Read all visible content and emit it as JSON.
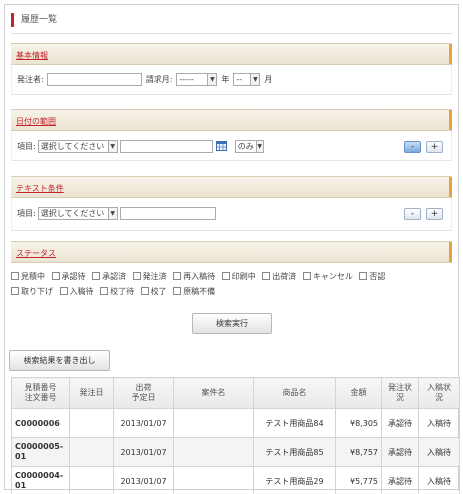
{
  "page": {
    "title": "履歴一覧"
  },
  "basic": {
    "heading": "基本情報",
    "orderer_label": "発注者:",
    "orderer_value": "",
    "billing_month_label": "請求月:",
    "year_value": "-----",
    "year_label": "年",
    "month_value": "--",
    "month_label": "月"
  },
  "date_range": {
    "heading": "日付の範囲",
    "item_label": "項目:",
    "item_select": "選択してください",
    "date_value": "",
    "mode_select": "のみ",
    "minus_label": "-",
    "plus_label": "+"
  },
  "text_cond": {
    "heading": "テキスト条件",
    "item_label": "項目:",
    "item_select": "選択してください",
    "text_value": "",
    "minus_label": "-",
    "plus_label": "+"
  },
  "status": {
    "heading": "ステータス",
    "options": [
      "見積中",
      "承認待",
      "承認済",
      "発注済",
      "再入稿待",
      "印刷中",
      "出荷済",
      "キャンセル",
      "否認",
      "取り下げ",
      "入稿待",
      "校了待",
      "校了",
      "原稿不備"
    ]
  },
  "actions": {
    "search_label": "検索実行",
    "export_label": "検索結果を書き出し"
  },
  "table": {
    "headers": [
      "見積番号\n注文番号",
      "発注日",
      "出荷\n予定日",
      "案件名",
      "商品名",
      "金額",
      "発注状\n況",
      "入稿状\n況"
    ],
    "rows": [
      {
        "number": "C0000006",
        "order_date": "",
        "ship_date": "2013/01/07",
        "project": "",
        "product": "テスト用商品84",
        "amount": "¥8,305",
        "order_status": "承認待",
        "upload_status": "入稿待"
      },
      {
        "number": "C0000005-01",
        "order_date": "",
        "ship_date": "2013/01/07",
        "project": "",
        "product": "テスト用商品85",
        "amount": "¥8,757",
        "order_status": "承認待",
        "upload_status": "入稿待"
      },
      {
        "number": "C0000004-01",
        "order_date": "",
        "ship_date": "2013/01/07",
        "project": "",
        "product": "テスト用商品29",
        "amount": "¥5,775",
        "order_status": "承認待",
        "upload_status": "入稿待"
      }
    ]
  }
}
